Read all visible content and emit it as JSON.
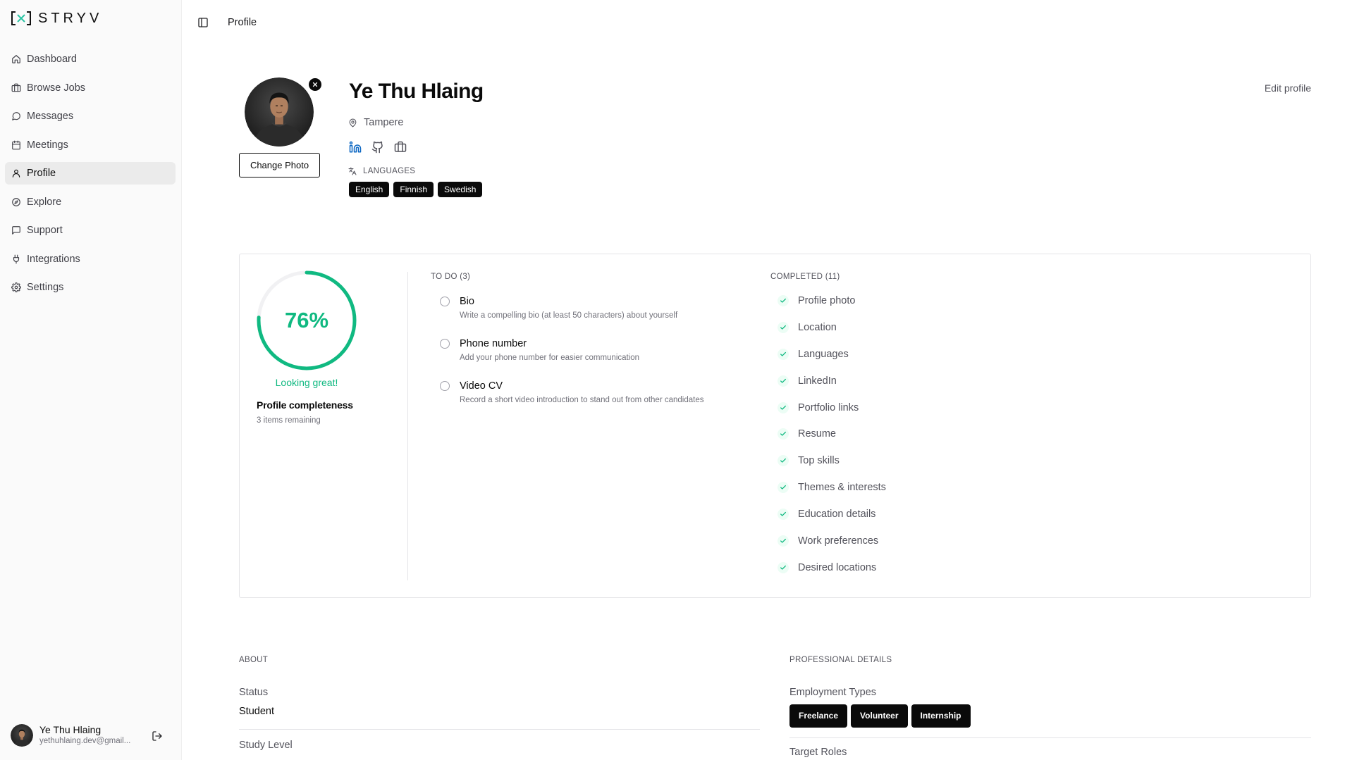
{
  "app": {
    "brand": "STRYV"
  },
  "colors": {
    "accent": "#10b981",
    "chip": "#0a0a0a",
    "linkedin": "#0a66c2",
    "logo_x": "#2bc4a4",
    "active_nav": "#ebebeb"
  },
  "header": {
    "breadcrumb": "Profile",
    "toggle_icon": "panel-left-icon"
  },
  "sidebar": {
    "items": [
      {
        "label": "Dashboard",
        "icon": "home-icon"
      },
      {
        "label": "Browse Jobs",
        "icon": "briefcase-icon"
      },
      {
        "label": "Messages",
        "icon": "message-circle-icon"
      },
      {
        "label": "Meetings",
        "icon": "calendar-icon"
      },
      {
        "label": "Profile",
        "icon": "user-icon",
        "active": true
      },
      {
        "label": "Explore",
        "icon": "compass-icon"
      },
      {
        "label": "Support",
        "icon": "message-square-icon"
      },
      {
        "label": "Integrations",
        "icon": "plug-icon"
      },
      {
        "label": "Settings",
        "icon": "gear-icon"
      }
    ],
    "user": {
      "name": "Ye Thu Hlaing",
      "email": "yethuhlaing.dev@gmail...",
      "logout_icon": "logout-icon"
    }
  },
  "profile": {
    "name": "Ye Thu Hlaing",
    "location": "Tampere",
    "change_photo_label": "Change Photo",
    "edit_profile_label": "Edit profile",
    "social_icons": [
      "linkedin-icon",
      "github-icon",
      "briefcase-icon"
    ],
    "languages_label": "LANGUAGES",
    "languages": [
      "English",
      "Finnish",
      "Swedish"
    ]
  },
  "completeness": {
    "percent": 76,
    "percent_label": "76%",
    "status": "Looking great!",
    "title": "Profile completeness",
    "remaining": "3 items remaining",
    "todo_header": "TO DO (3)",
    "todo": [
      {
        "title": "Bio",
        "description": "Write a compelling bio (at least 50 characters) about yourself"
      },
      {
        "title": "Phone number",
        "description": "Add your phone number for easier communication"
      },
      {
        "title": "Video CV",
        "description": "Record a short video introduction to stand out from other candidates"
      }
    ],
    "completed_header": "COMPLETED (11)",
    "completed": [
      "Profile photo",
      "Location",
      "Languages",
      "LinkedIn",
      "Portfolio links",
      "Resume",
      "Top skills",
      "Themes & interests",
      "Education details",
      "Work preferences",
      "Desired locations"
    ]
  },
  "about": {
    "heading": "ABOUT",
    "status_label": "Status",
    "status_value": "Student",
    "study_level_label": "Study Level"
  },
  "professional": {
    "heading": "PROFESSIONAL DETAILS",
    "employment_types_label": "Employment Types",
    "employment_types": [
      "Freelance",
      "Volunteer",
      "Internship"
    ],
    "target_roles_label": "Target Roles"
  }
}
